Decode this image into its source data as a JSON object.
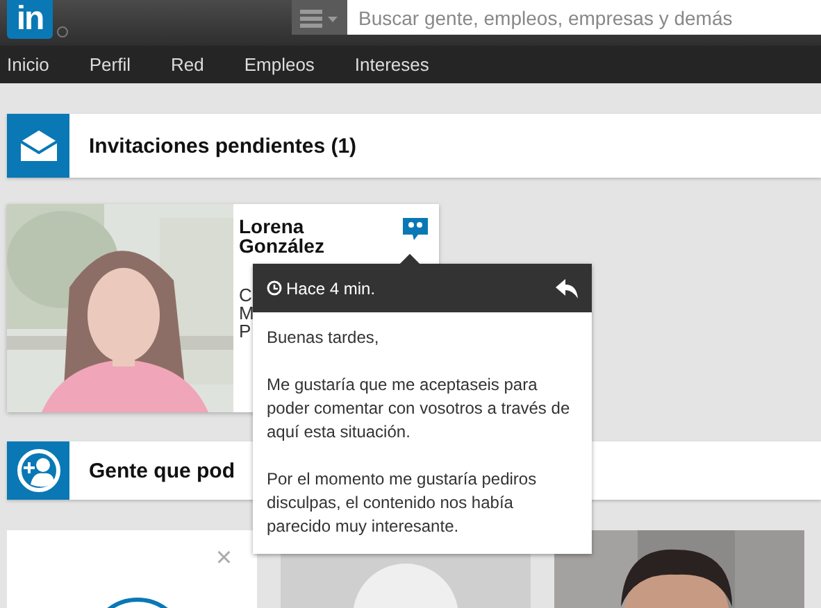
{
  "header": {
    "logo": "in",
    "search": {
      "placeholder": "Buscar gente, empleos, empresas y demás"
    }
  },
  "nav": [
    {
      "label": "Inicio"
    },
    {
      "label": "Perfil"
    },
    {
      "label": "Red"
    },
    {
      "label": "Empleos"
    },
    {
      "label": "Intereses"
    }
  ],
  "invitations": {
    "title": "Invitaciones pendientes (1)",
    "items": [
      {
        "name": "Lorena González",
        "details": [
          "C",
          "M",
          "P"
        ],
        "message": {
          "time": "Hace 4 min.",
          "paragraphs": [
            "Buenas tardes,",
            "Me gustaría que me aceptaseis para poder comentar con vosotros a través de aquí esta situación.",
            "Por el momento me gustaría pediros disculpas, el contenido nos había parecido muy interesante."
          ]
        }
      }
    ]
  },
  "people": {
    "title": "Gente que pod",
    "cards": [
      {
        "kind": "blank",
        "close": "×"
      },
      {
        "kind": "silhouette"
      },
      {
        "kind": "picture"
      }
    ]
  }
}
